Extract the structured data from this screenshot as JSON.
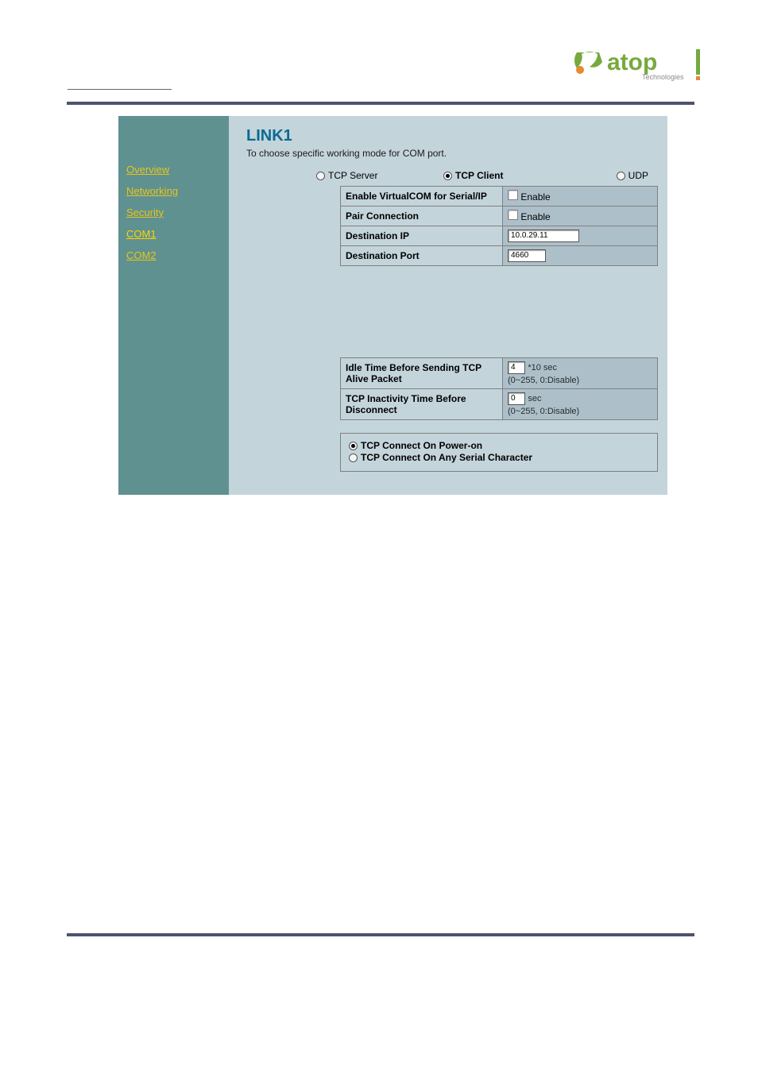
{
  "logo": {
    "name": "atop",
    "sub": "Technologies"
  },
  "sidebar": {
    "items": [
      {
        "label": "Overview",
        "active": false
      },
      {
        "label": "Networking",
        "active": false
      },
      {
        "label": "Security",
        "active": false
      },
      {
        "label": "COM1",
        "active": true
      },
      {
        "label": "COM2",
        "active": false
      }
    ]
  },
  "main": {
    "title": "LINK1",
    "subtitle": "To choose specific working mode for COM port.",
    "modes": {
      "tcp_server": "TCP Server",
      "tcp_client": "TCP Client",
      "udp": "UDP",
      "selected": "tcp_client"
    },
    "rows": {
      "vcom_label": "Enable VirtualCOM for Serial/IP",
      "vcom_enable": "Enable",
      "pair_label": "Pair Connection",
      "pair_enable": "Enable",
      "dest_ip_label": "Destination IP",
      "dest_ip_value": "10.0.29.11",
      "dest_port_label": "Destination Port",
      "dest_port_value": "4660",
      "idle_label": "Idle Time Before Sending TCP Alive Packet",
      "idle_value": "4",
      "idle_unit": "*10 sec",
      "idle_hint": "(0~255, 0:Disable)",
      "inact_label": "TCP Inactivity Time Before Disconnect",
      "inact_value": "0",
      "inact_unit": "sec",
      "inact_hint": "(0~255, 0:Disable)"
    },
    "connect": {
      "power": "TCP Connect On Power-on",
      "serial": "TCP Connect On Any Serial Character",
      "selected": "power"
    }
  }
}
